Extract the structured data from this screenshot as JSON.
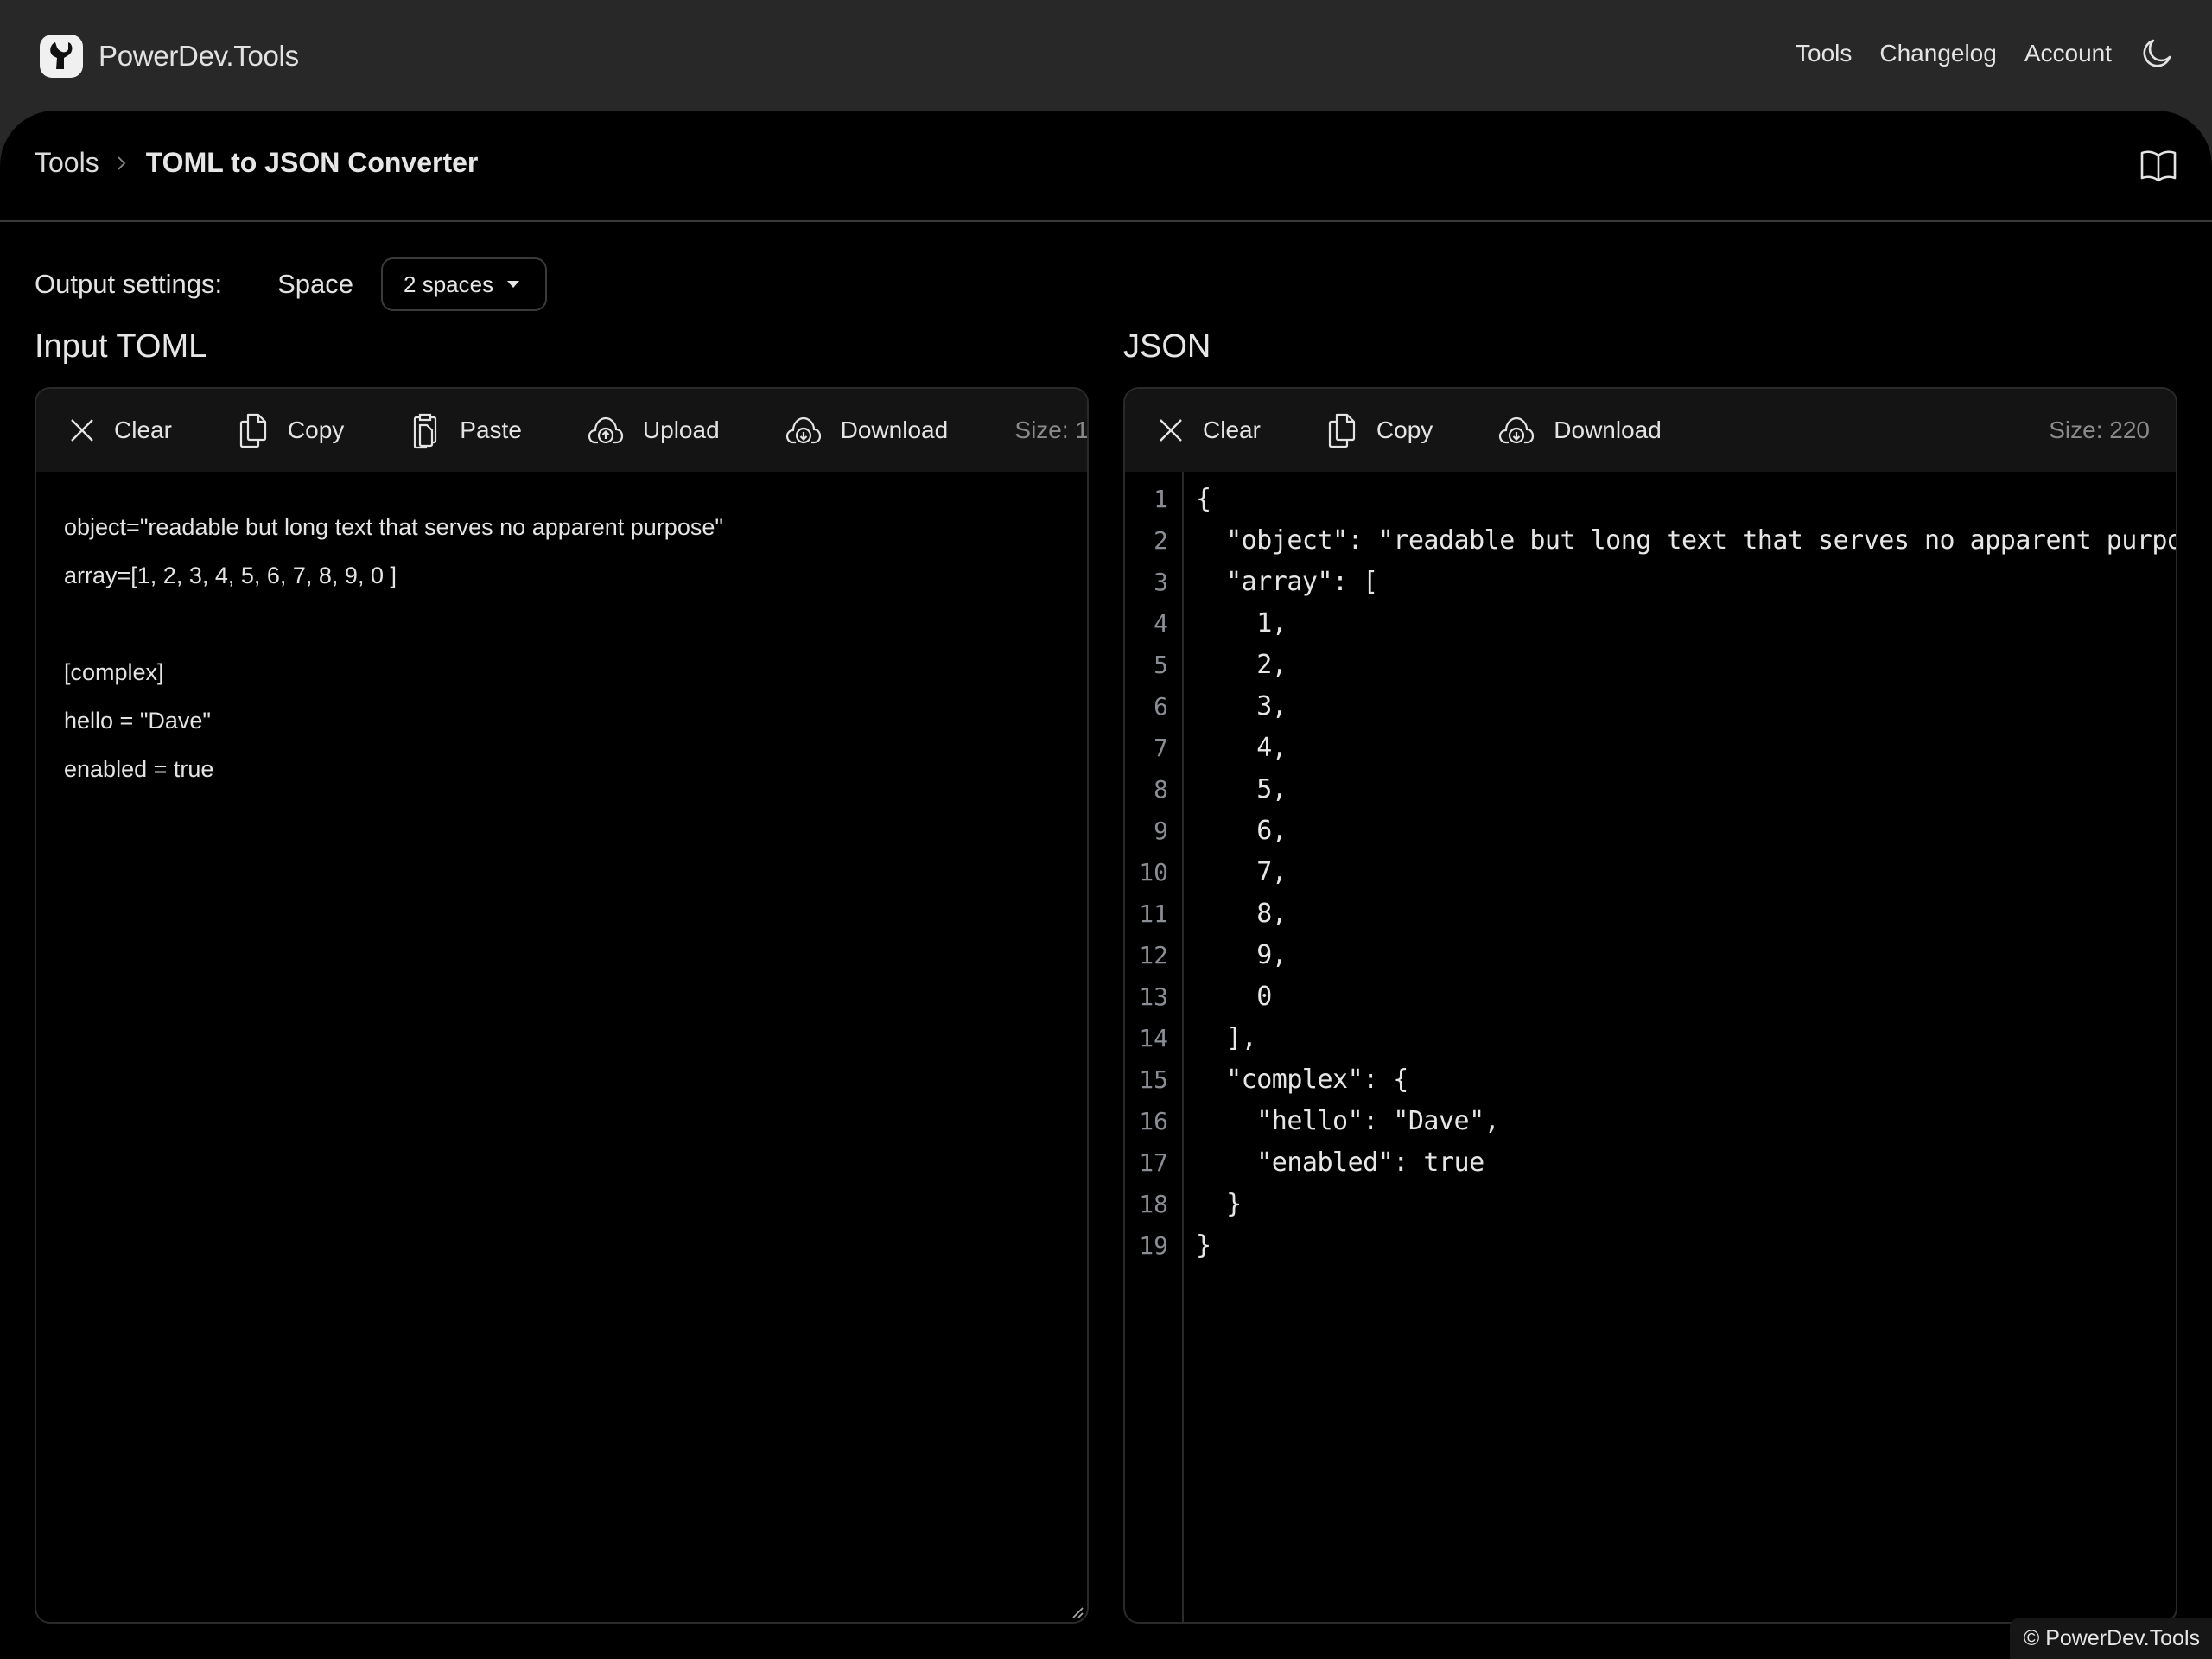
{
  "header": {
    "brand": "PowerDev.Tools",
    "nav": [
      {
        "label": "Tools"
      },
      {
        "label": "Changelog"
      },
      {
        "label": "Account"
      }
    ],
    "theme_icon": "moon-icon"
  },
  "breadcrumb": {
    "root": "Tools",
    "current": "TOML to JSON Converter",
    "docs_icon": "book-icon"
  },
  "settings": {
    "label": "Output settings:",
    "space_label": "Space",
    "space_value": "2 spaces"
  },
  "input": {
    "title": "Input TOML",
    "toolbar": {
      "clear": "Clear",
      "copy": "Copy",
      "paste": "Paste",
      "upload": "Upload",
      "download": "Download",
      "size": "Size: 1"
    },
    "lines": [
      "object=\"readable but long text that serves no apparent purpose\"",
      "array=[1, 2, 3, 4, 5, 6, 7, 8, 9, 0 ]",
      "",
      "[complex]",
      "hello = \"Dave\"",
      "enabled = true"
    ]
  },
  "output": {
    "title": "JSON",
    "toolbar": {
      "clear": "Clear",
      "copy": "Copy",
      "download": "Download",
      "size": "Size: 220"
    },
    "line_numbers": [
      "1",
      "2",
      "3",
      "4",
      "5",
      "6",
      "7",
      "8",
      "9",
      "10",
      "11",
      "12",
      "13",
      "14",
      "15",
      "16",
      "17",
      "18",
      "19"
    ],
    "lines": [
      "{",
      "  \"object\": \"readable but long text that serves no apparent purpose\",",
      "  \"array\": [",
      "    1,",
      "    2,",
      "    3,",
      "    4,",
      "    5,",
      "    6,",
      "    7,",
      "    8,",
      "    9,",
      "    0",
      "  ],",
      "  \"complex\": {",
      "    \"hello\": \"Dave\",",
      "    \"enabled\": true",
      "  }",
      "}"
    ]
  },
  "footer": {
    "copyright": "© PowerDev.Tools"
  }
}
